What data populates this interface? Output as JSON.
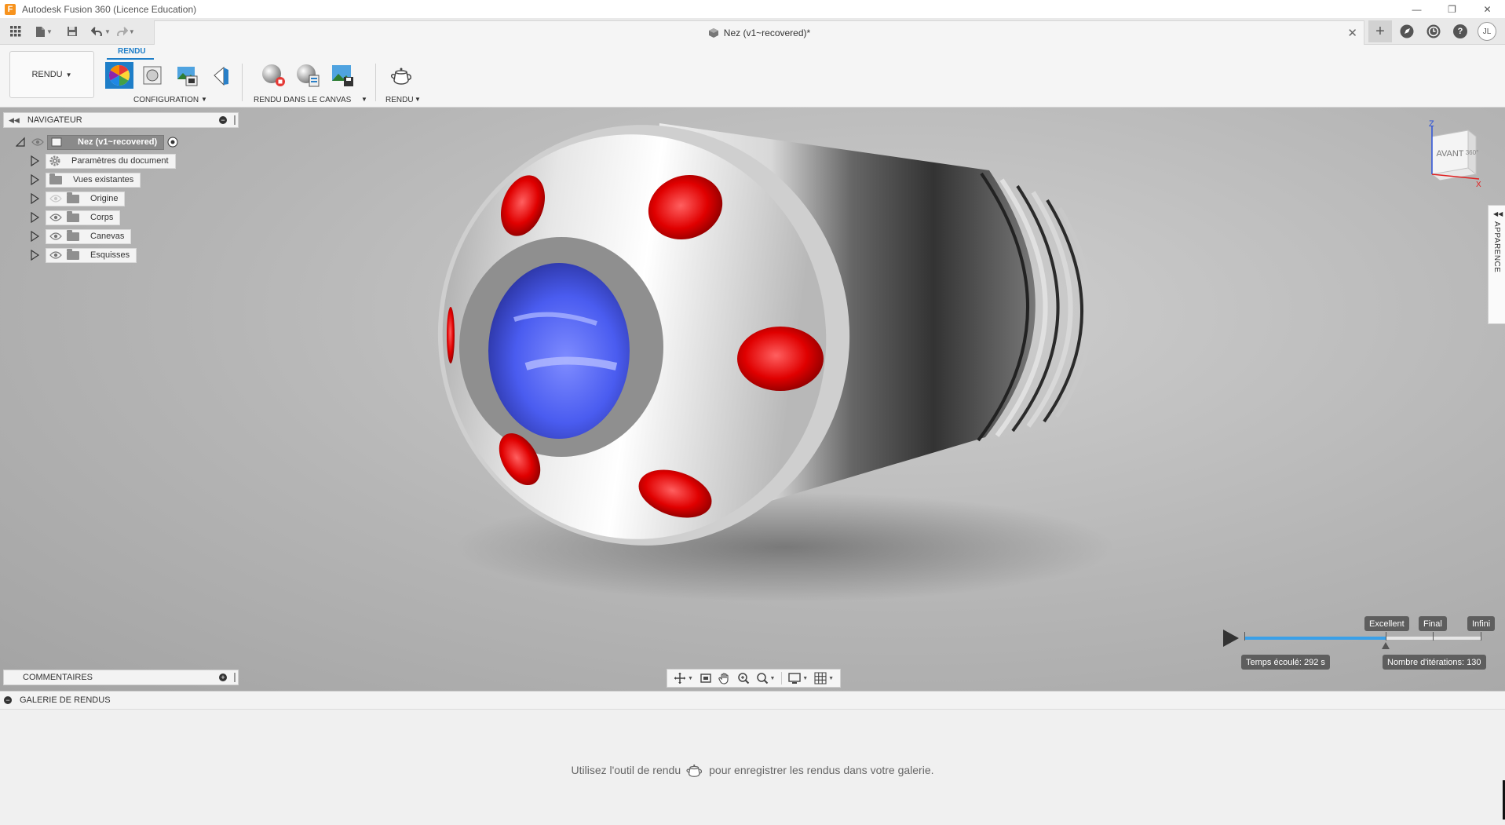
{
  "window": {
    "app_title": "Autodesk Fusion 360 (Licence Education)",
    "logo_letter": "F",
    "minimize_glyph": "—",
    "restore_glyph": "❐",
    "close_glyph": "✕"
  },
  "tab": {
    "document_title": "Nez (v1~recovered)*",
    "close_glyph": "✕",
    "new_tab_glyph": "+",
    "user_initials": "JL",
    "help_glyph": "?"
  },
  "ribbon": {
    "workspace_label": "RENDU",
    "active_tab": "RENDU",
    "groups": {
      "setup": "CONFIGURATION",
      "in_canvas": "RENDU DANS LE CANVAS",
      "render": "RENDU"
    }
  },
  "navigator": {
    "title": "NAVIGATEUR",
    "root": "Nez (v1~recovered)",
    "items": [
      {
        "label": "Paramètres du document",
        "icon": "gear-icon"
      },
      {
        "label": "Vues existantes",
        "icon": "folder-icon"
      },
      {
        "label": "Origine",
        "icon": "folder-icon"
      },
      {
        "label": "Corps",
        "icon": "folder-icon"
      },
      {
        "label": "Canevas",
        "icon": "folder-icon"
      },
      {
        "label": "Esquisses",
        "icon": "folder-icon"
      }
    ]
  },
  "comments": {
    "title": "COMMENTAIRES"
  },
  "viewcube": {
    "face_front": "AVANT",
    "face_right": "360°",
    "axis_z": "Z",
    "axis_x": "X"
  },
  "appearance": {
    "label": "APPARENCE"
  },
  "render_progress": {
    "quality_levels": [
      "Excellent",
      "Final",
      "Infini"
    ],
    "progress_fraction": 0.6,
    "elapsed": "Temps écoulé: 292 s",
    "iterations": "Nombre d'itérations: 130"
  },
  "gallery": {
    "title": "GALERIE DE RENDUS",
    "message_before": "Utilisez l'outil de rendu",
    "message_after": "pour enregistrer les rendus dans votre galerie."
  },
  "colors": {
    "accent": "#1e7ec8",
    "progress": "#3aa0e8",
    "hole_red": "#e00000",
    "bore_blue": "#4a5cf0"
  }
}
